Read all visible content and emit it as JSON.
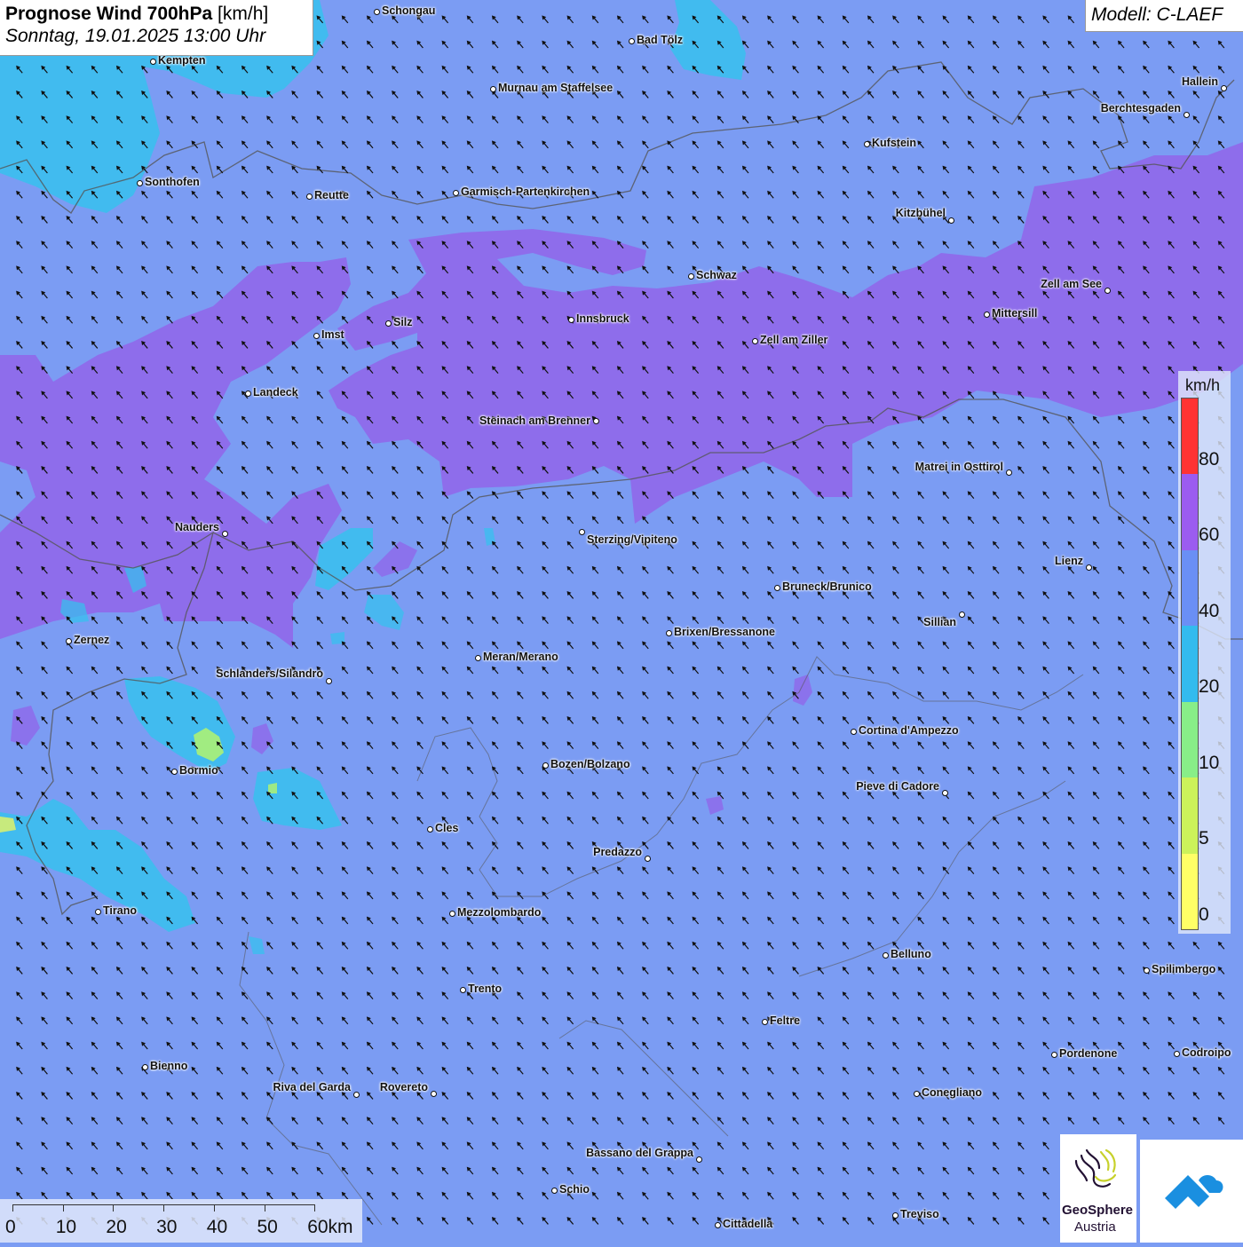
{
  "header": {
    "title_bold": "Prognose Wind 700hPa",
    "title_unit": "[km/h]",
    "subtitle": "Sonntag, 19.01.2025 13:00 Uhr",
    "model": "Modell: C-LAEF"
  },
  "legend": {
    "unit": "km/h",
    "ticks": [
      "80",
      "60",
      "40",
      "20",
      "10",
      "5",
      "0"
    ],
    "colors": [
      "#ff3333",
      "#9b5cf0",
      "#6a8ff5",
      "#33bbee",
      "#88ee88",
      "#ccf25a",
      "#ffff66"
    ]
  },
  "scale": {
    "labels": [
      "0",
      "10",
      "20",
      "30",
      "40",
      "50",
      "60km"
    ]
  },
  "logos": {
    "geosphere_name": "GeoSphere",
    "geosphere_country": "Austria"
  },
  "map": {
    "background_color": "#7b9cf3",
    "wind_direction": "from south-east",
    "cities": [
      {
        "name": "Schongau",
        "label_side": "right"
      },
      {
        "name": "Bad Tölz",
        "label_side": "right"
      },
      {
        "name": "Kempten",
        "label_side": "right"
      },
      {
        "name": "Murnau am Staffelsee",
        "label_side": "right"
      },
      {
        "name": "Hallein",
        "label_side": "left"
      },
      {
        "name": "Berchtesgaden",
        "label_side": "left"
      },
      {
        "name": "Kufstein",
        "label_side": "right"
      },
      {
        "name": "Sonthofen",
        "label_side": "right"
      },
      {
        "name": "Reutte",
        "label_side": "right"
      },
      {
        "name": "Garmisch-Partenkirchen",
        "label_side": "right"
      },
      {
        "name": "Kitzbühel",
        "label_side": "left"
      },
      {
        "name": "Schwaz",
        "label_side": "right"
      },
      {
        "name": "Zell am See",
        "label_side": "left"
      },
      {
        "name": "Mittersill",
        "label_side": "right"
      },
      {
        "name": "Innsbruck",
        "label_side": "right"
      },
      {
        "name": "Silz",
        "label_side": "right"
      },
      {
        "name": "Imst",
        "label_side": "right"
      },
      {
        "name": "Zell am Ziller",
        "label_side": "right"
      },
      {
        "name": "Landeck",
        "label_side": "right"
      },
      {
        "name": "Steinach am Brenner",
        "label_side": "left"
      },
      {
        "name": "Matrei in Osttirol",
        "label_side": "left"
      },
      {
        "name": "Nauders",
        "label_side": "left"
      },
      {
        "name": "Sterzing/Vipiteno",
        "label_side": "right"
      },
      {
        "name": "Lienz",
        "label_side": "left"
      },
      {
        "name": "Bruneck/Brunico",
        "label_side": "right"
      },
      {
        "name": "Sillian",
        "label_side": "left"
      },
      {
        "name": "Zernez",
        "label_side": "right"
      },
      {
        "name": "Brixen/Bressanone",
        "label_side": "right"
      },
      {
        "name": "Meran/Merano",
        "label_side": "right"
      },
      {
        "name": "Schlanders/Silandro",
        "label_side": "left"
      },
      {
        "name": "Cortina d'Ampezzo",
        "label_side": "right"
      },
      {
        "name": "Bozen/Bolzano",
        "label_side": "right"
      },
      {
        "name": "Bormio",
        "label_side": "right"
      },
      {
        "name": "Pieve di Cadore",
        "label_side": "left"
      },
      {
        "name": "Cles",
        "label_side": "right"
      },
      {
        "name": "Predazzo",
        "label_side": "left"
      },
      {
        "name": "Tirano",
        "label_side": "right"
      },
      {
        "name": "Mezzolombardo",
        "label_side": "right"
      },
      {
        "name": "Belluno",
        "label_side": "right"
      },
      {
        "name": "Spilimbergo",
        "label_side": "right"
      },
      {
        "name": "Trento",
        "label_side": "right"
      },
      {
        "name": "Feltre",
        "label_side": "right"
      },
      {
        "name": "Pordenone",
        "label_side": "right"
      },
      {
        "name": "Codroipo",
        "label_side": "right"
      },
      {
        "name": "Bienno",
        "label_side": "right"
      },
      {
        "name": "Riva del Garda",
        "label_side": "left"
      },
      {
        "name": "Rovereto",
        "label_side": "left"
      },
      {
        "name": "Conegliano",
        "label_side": "right"
      },
      {
        "name": "Bassano del Grappa",
        "label_side": "left"
      },
      {
        "name": "Schio",
        "label_side": "right"
      },
      {
        "name": "Treviso",
        "label_side": "right"
      },
      {
        "name": "Cittadella",
        "label_side": "right"
      }
    ]
  }
}
